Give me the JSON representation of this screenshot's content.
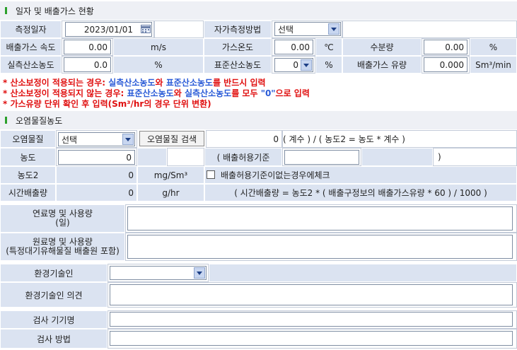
{
  "section1": {
    "title": "일자 및 배출가스 현황"
  },
  "row1": {
    "date_label": "측정일자",
    "date_value": "2023/01/01",
    "method_label": "자가측정방법",
    "method_value": "선택"
  },
  "row2": {
    "speed_label": "배출가스 속도",
    "speed_value": "0.00",
    "speed_unit": "m/s",
    "temp_label": "가스온도",
    "temp_value": "0.00",
    "temp_unit": "℃",
    "moisture_label": "수분량",
    "moisture_value": "0.00",
    "moisture_unit": "%"
  },
  "row3": {
    "o2_label": "실측산소농도",
    "o2_value": "0.0",
    "o2_unit": "%",
    "std_o2_label": "표준산소농도",
    "std_o2_value": "0",
    "std_o2_unit": "%",
    "flow_label": "배출가스 유량",
    "flow_value": "0.000",
    "flow_unit": "Sm³/min"
  },
  "notices": {
    "n1_a": "* 산소보정이 적용되는 경우: ",
    "n1_b": "실측산소농도",
    "n1_c": "와 ",
    "n1_d": "표준산소농도",
    "n1_e": "를 반드시 입력",
    "n2_a": "* 산소보정이 적용되지 않는 경우: ",
    "n2_b": "표준산소농도",
    "n2_c": "와 ",
    "n2_d": "실측산소농도",
    "n2_e": "를 모두 ",
    "n2_f": "\"0\"",
    "n2_g": "으로 입력",
    "n3": "* 가스유량 단위 확인 후 입력(Sm³/hr의 경우 단위 변환)"
  },
  "section2": {
    "title": "오염물질농도"
  },
  "pollutant": {
    "label": "오염물질",
    "select_value": "선택",
    "search_button": "오염물질 검색",
    "count_value": "0",
    "formula_count": "( 계수 ) / ( 농도2 = 농도 * 계수 )",
    "conc_label": "농도",
    "conc_value": "0",
    "limit_open": "( 배출허용기준",
    "limit_close": ")",
    "conc2_label": "농도2",
    "conc2_value": "0",
    "conc2_unit": "mg/Sm³",
    "check_label": "배출허용기준이없는경우에체크",
    "hourly_label": "시간배출량",
    "hourly_value": "0",
    "hourly_unit": "g/hr",
    "hourly_formula": "( 시간배출량 = 농도2 * ( 배출구정보의 배출가스유량 * 60 ) / 1000 )"
  },
  "fuel": {
    "fuel_label_1": "연료명 및 사용량",
    "fuel_label_2": "(일)",
    "raw_label_1": "원료명 및 사용량",
    "raw_label_2": "(특정대기유해물질 배출원 포함)"
  },
  "engineer": {
    "label": "환경기술인",
    "opinion_label": "환경기술인 의견"
  },
  "inspection": {
    "device_label": "검사 기기명",
    "method_label": "검사 방법"
  }
}
